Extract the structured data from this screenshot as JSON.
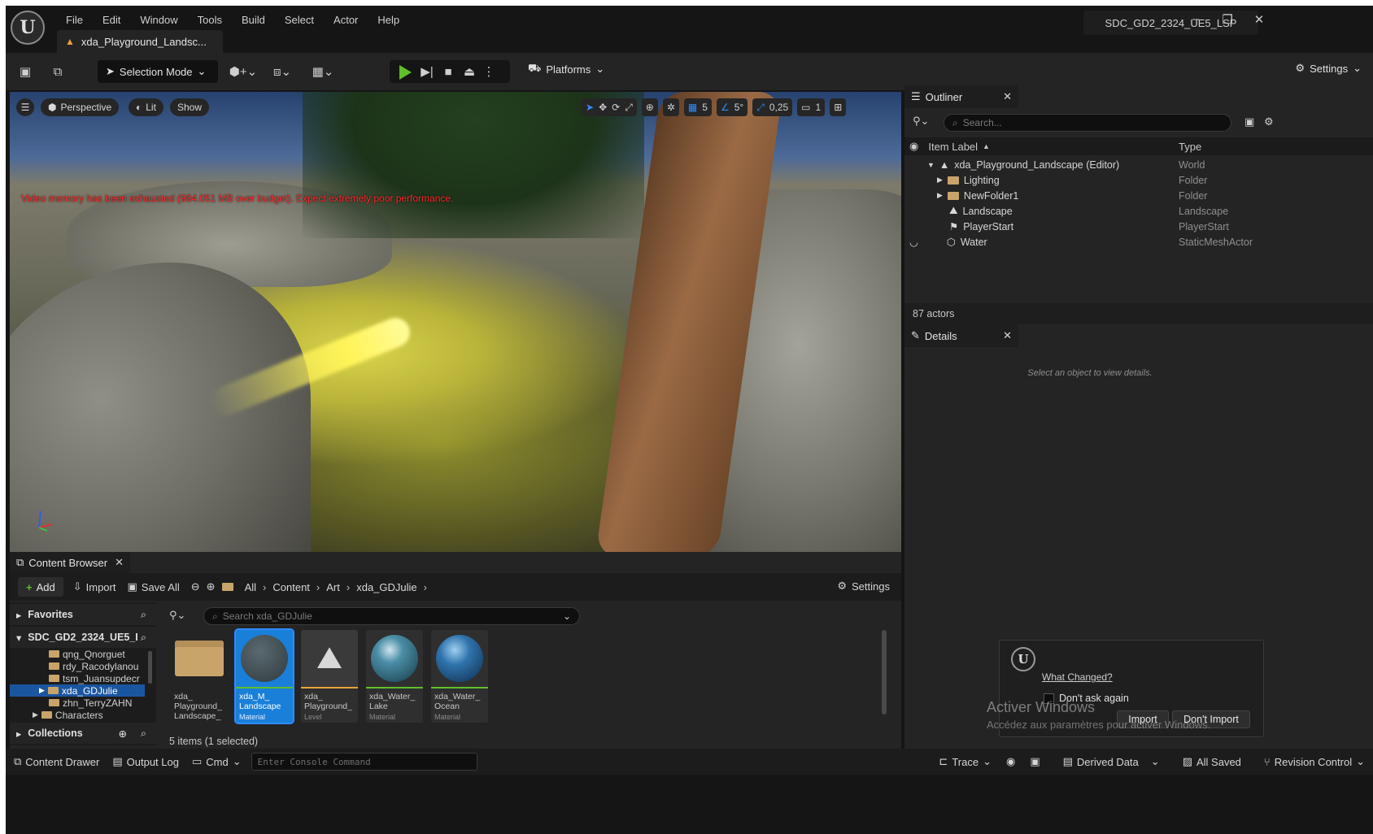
{
  "window": {
    "project_name": "SDC_GD2_2324_UE5_LSP",
    "minimize": "–",
    "restore": "❐",
    "close": "✕"
  },
  "menu": [
    "File",
    "Edit",
    "Window",
    "Tools",
    "Build",
    "Select",
    "Actor",
    "Help"
  ],
  "doc_tab": {
    "label": "xda_Playground_Landsc..."
  },
  "toolbar": {
    "selection_mode": "Selection Mode",
    "platforms": "Platforms",
    "settings": "Settings"
  },
  "viewport": {
    "perspective": "Perspective",
    "lit": "Lit",
    "show": "Show",
    "grid_snap": "5",
    "rotation_snap": "5°",
    "scale_snap": "0,25",
    "camera_speed": "1",
    "warning": "Video memory has been exhausted (984.051 MB over budget). Expect extremely poor performance."
  },
  "outliner": {
    "tab": "Outliner",
    "search_placeholder": "Search...",
    "col_label": "Item Label",
    "col_type": "Type",
    "rows": [
      {
        "label": "xda_Playground_Landscape (Editor)",
        "type": "World"
      },
      {
        "label": "Lighting",
        "type": "Folder"
      },
      {
        "label": "NewFolder1",
        "type": "Folder"
      },
      {
        "label": "Landscape",
        "type": "Landscape"
      },
      {
        "label": "PlayerStart",
        "type": "PlayerStart"
      },
      {
        "label": "Water",
        "type": "StaticMeshActor"
      }
    ],
    "actor_count": "87 actors"
  },
  "details": {
    "tab": "Details",
    "hint": "Select an object to view details."
  },
  "popup": {
    "link": "What Changed?",
    "checkbox": "Don't ask again",
    "import": "Import",
    "dont_import": "Don't Import"
  },
  "watermark": {
    "title": "Activer Windows",
    "sub": "Accédez aux paramètres pour activer Windows."
  },
  "content_browser": {
    "tab": "Content Browser",
    "add": "Add",
    "import": "Import",
    "save_all": "Save All",
    "breadcrumb": [
      "All",
      "Content",
      "Art",
      "xda_GDJulie"
    ],
    "settings": "Settings",
    "favorites": "Favorites",
    "project_root": "SDC_GD2_2324_UE5_I",
    "folders": [
      "qng_Qnorguet",
      "rdy_Racodylanou",
      "tsm_Juansupdecr",
      "xda_GDJulie",
      "zhn_TerryZAHN",
      "Characters"
    ],
    "collections": "Collections",
    "search_placeholder": "Search xda_GDJulie",
    "assets": [
      {
        "name": "xda_ Playground_ Landscape_",
        "kind": ""
      },
      {
        "name": "xda_M_ Landscape",
        "kind": "Material"
      },
      {
        "name": "xda_ Playground_",
        "kind": "Level"
      },
      {
        "name": "xda_Water_ Lake",
        "kind": "Material"
      },
      {
        "name": "xda_Water_ Ocean",
        "kind": "Material"
      }
    ],
    "status": "5 items (1 selected)"
  },
  "bottom": {
    "content_drawer": "Content Drawer",
    "output_log": "Output Log",
    "cmd": "Cmd",
    "console_placeholder": "Enter Console Command",
    "trace": "Trace",
    "derived_data": "Derived Data",
    "all_saved": "All Saved",
    "revision_control": "Revision Control"
  },
  "colors": {
    "accent": "#2f8cff",
    "play": "#5fbf2a",
    "warning": "#ff2a2a"
  }
}
